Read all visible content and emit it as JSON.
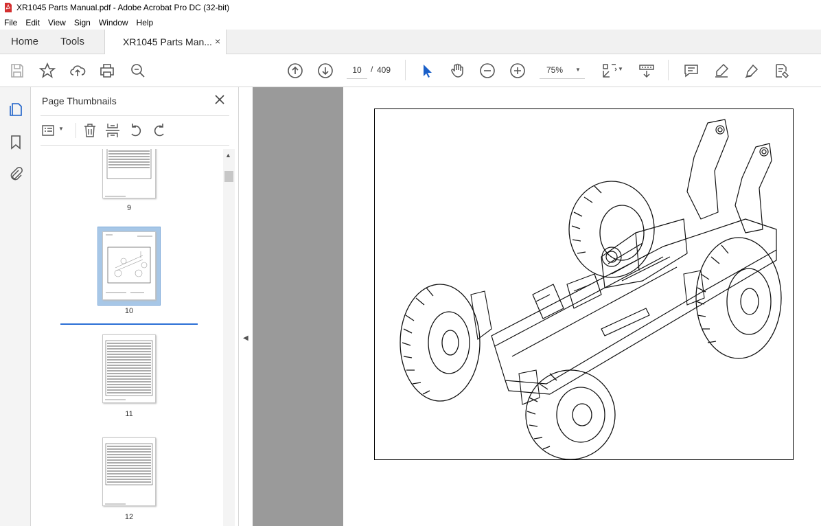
{
  "window": {
    "title": "XR1045 Parts Manual.pdf - Adobe Acrobat Pro DC (32-bit)"
  },
  "menu": [
    "File",
    "Edit",
    "View",
    "Sign",
    "Window",
    "Help"
  ],
  "tabs": {
    "home": "Home",
    "tools": "Tools",
    "document": "XR1045 Parts Man...",
    "close_glyph": "×"
  },
  "navigation": {
    "current_page": "10",
    "separator": "/",
    "total_pages": "409"
  },
  "zoom": {
    "value": "75%"
  },
  "panel": {
    "title": "Page Thumbnails",
    "thumbnails": [
      {
        "label": "9"
      },
      {
        "label": "10"
      },
      {
        "label": "11"
      },
      {
        "label": "12"
      }
    ],
    "selected_page": "10"
  },
  "colors": {
    "accent": "#2b6fd6",
    "selection": "#a7c7e7",
    "gray_canvas": "#9a9a9a",
    "pdf_red": "#d32f2f"
  },
  "icons": [
    "save-icon",
    "bookmark-star-icon",
    "upload-icon",
    "print-icon",
    "zoom-search-icon",
    "page-up-icon",
    "page-down-icon",
    "select-cursor-icon",
    "hand-icon",
    "zoom-out-icon",
    "zoom-in-icon",
    "fit-page-icon",
    "scroll-mode-icon",
    "comment-icon",
    "highlight-icon",
    "draw-icon",
    "fill-sign-icon"
  ]
}
